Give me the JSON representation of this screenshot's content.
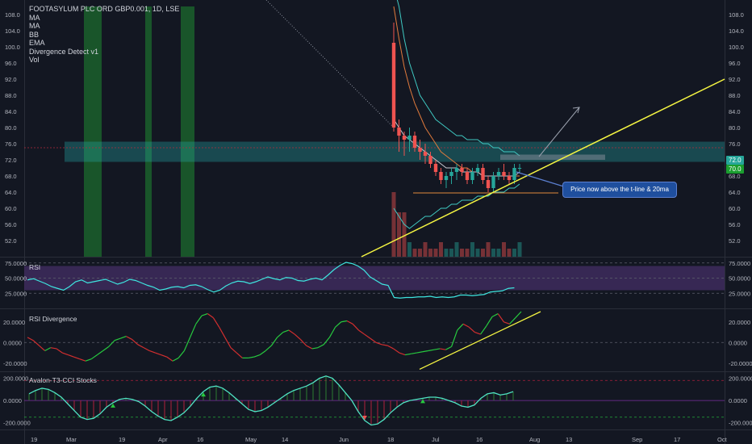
{
  "legend": {
    "symbol_line": "FOOTASYLUM PLC ORD GBP0.001, 1D, LSE",
    "indicators": [
      "MA",
      "MA",
      "BB",
      "EMA",
      "Divergence Detect v1",
      "Vol"
    ]
  },
  "annotation": {
    "text": "Price now above the t-line & 20ma"
  },
  "price_labels": {
    "last": "70.0",
    "target": "72.0"
  },
  "colors": {
    "background": "#131722",
    "up": "#26a69a",
    "down": "#ef5350",
    "trendline": "#f5f542",
    "zone": "#26a6a6",
    "rsi_line": "#3ee6e0",
    "rsi_band": "#3c2a5a",
    "green_bar": "#1c6b2d",
    "note": "#1f4f9e",
    "cci_line": "#4fe3c3",
    "hist_neg": "#b0203c",
    "hist_pos": "#2e7d32"
  },
  "chart_data": [
    {
      "type": "candlestick",
      "title": "FOOTASYLUM PLC ORD GBP0.001, 1D, LSE",
      "y_ticks": [
        "108.0",
        "104.0",
        "100.0",
        "96.0",
        "92.0",
        "88.0",
        "84.0",
        "80.0",
        "76.0",
        "72.0",
        "68.0",
        "64.0",
        "60.0",
        "56.0",
        "52.0"
      ],
      "ylim": [
        48,
        110
      ],
      "x_ticks": [
        "19",
        "Mar",
        "19",
        "Apr",
        "16",
        "May",
        "14",
        "Jun",
        "18",
        "Jul",
        "16",
        "Aug",
        "13",
        "Sep",
        "17",
        "Oct"
      ],
      "candles": [
        {
          "o": 101,
          "h": 106,
          "l": 79,
          "c": 80
        },
        {
          "o": 80,
          "h": 82,
          "l": 74,
          "c": 78
        },
        {
          "o": 78,
          "h": 79,
          "l": 73,
          "c": 77
        },
        {
          "o": 77,
          "h": 80,
          "l": 74,
          "c": 78
        },
        {
          "o": 78,
          "h": 79,
          "l": 74,
          "c": 75
        },
        {
          "o": 75,
          "h": 77,
          "l": 72,
          "c": 74
        },
        {
          "o": 74,
          "h": 76,
          "l": 71,
          "c": 73
        },
        {
          "o": 73,
          "h": 74,
          "l": 70,
          "c": 71
        },
        {
          "o": 71,
          "h": 72,
          "l": 68,
          "c": 69
        },
        {
          "o": 69,
          "h": 70,
          "l": 66,
          "c": 67
        },
        {
          "o": 67,
          "h": 69,
          "l": 65,
          "c": 68
        },
        {
          "o": 68,
          "h": 70,
          "l": 66,
          "c": 69
        },
        {
          "o": 69,
          "h": 71,
          "l": 67,
          "c": 70
        },
        {
          "o": 70,
          "h": 71,
          "l": 68,
          "c": 69
        },
        {
          "o": 69,
          "h": 70,
          "l": 66,
          "c": 67
        },
        {
          "o": 67,
          "h": 70,
          "l": 66,
          "c": 69
        },
        {
          "o": 69,
          "h": 71,
          "l": 68,
          "c": 70
        },
        {
          "o": 70,
          "h": 71,
          "l": 66,
          "c": 67
        },
        {
          "o": 67,
          "h": 68,
          "l": 64,
          "c": 65
        },
        {
          "o": 65,
          "h": 69,
          "l": 64,
          "c": 68
        },
        {
          "o": 68,
          "h": 70,
          "l": 67,
          "c": 69
        },
        {
          "o": 69,
          "h": 71,
          "l": 67,
          "c": 68
        },
        {
          "o": 68,
          "h": 69,
          "l": 66,
          "c": 67
        },
        {
          "o": 67,
          "h": 71,
          "l": 66,
          "c": 70
        },
        {
          "o": 70,
          "h": 71,
          "l": 69,
          "c": 70
        }
      ],
      "ma_slow": [
        110,
        102,
        95,
        90,
        86,
        83,
        80,
        78,
        76,
        74,
        73,
        72,
        71,
        70,
        70,
        69,
        69,
        68,
        68,
        68,
        68,
        68,
        68,
        68,
        68
      ],
      "ma_fast": [
        82,
        80,
        78,
        77,
        76,
        75,
        74,
        73,
        72,
        71,
        70,
        70,
        70,
        69,
        69,
        69,
        69,
        68,
        68,
        68,
        68,
        68,
        68,
        68,
        69
      ],
      "bb_upper": [
        120,
        110,
        102,
        96,
        92,
        88,
        86,
        84,
        82,
        81,
        80,
        79,
        78,
        78,
        77,
        77,
        77,
        76,
        76,
        75,
        75,
        74,
        74,
        74,
        73
      ],
      "bb_lower": [
        60,
        58,
        56,
        55,
        56,
        57,
        58,
        58,
        59,
        60,
        60,
        61,
        61,
        62,
        62,
        62,
        63,
        63,
        63,
        64,
        64,
        64,
        65,
        65,
        66
      ],
      "zones": [
        {
          "from": 71.5,
          "to": 76.5
        }
      ],
      "horizontal_levels": [
        63.8,
        75.0
      ],
      "green_bands": [
        "Feb 26 - Mar 3",
        "Mar 26",
        "Apr 9 - Apr 12"
      ]
    },
    {
      "type": "line",
      "title": "RSI",
      "y_ticks": [
        "75.0000",
        "50.0000",
        "25.0000"
      ],
      "ylim": [
        0,
        80
      ],
      "values": [
        47,
        49,
        45,
        41,
        36,
        33,
        30,
        36,
        44,
        47,
        42,
        44,
        46,
        48,
        44,
        40,
        43,
        48,
        46,
        42,
        38,
        35,
        30,
        32,
        35,
        36,
        34,
        38,
        39,
        36,
        31,
        27,
        30,
        37,
        42,
        45,
        44,
        41,
        44,
        48,
        52,
        49,
        47,
        51,
        50,
        46,
        45,
        48,
        50,
        47,
        55,
        64,
        71,
        76,
        74,
        70,
        63,
        52,
        46,
        40,
        38,
        18,
        17,
        18,
        18,
        19,
        19,
        20,
        18,
        19,
        18,
        19,
        22,
        22,
        21,
        22,
        23,
        27,
        28,
        29,
        33,
        34
      ]
    },
    {
      "type": "line",
      "title": "RSI Divergence",
      "y_ticks": [
        "20.0000",
        "0.0000",
        "-20.0000"
      ],
      "ylim": [
        -28,
        30
      ],
      "values": [
        5,
        2,
        -3,
        -8,
        -5,
        -6,
        -10,
        -12,
        -14,
        -16,
        -18,
        -16,
        -12,
        -8,
        -4,
        2,
        4,
        6,
        3,
        -2,
        -5,
        -8,
        -10,
        -12,
        -14,
        -18,
        -15,
        -8,
        5,
        18,
        26,
        28,
        24,
        15,
        5,
        -5,
        -10,
        -15,
        -15,
        -14,
        -12,
        -8,
        -3,
        5,
        10,
        12,
        8,
        3,
        -3,
        -6,
        -5,
        -2,
        5,
        15,
        20,
        21,
        18,
        12,
        8,
        4,
        0,
        -2,
        -3,
        -6,
        -10,
        -12,
        -11,
        -10,
        -9,
        -8,
        -7,
        -6,
        -7,
        -4,
        12,
        18,
        15,
        10,
        8,
        16,
        25,
        28,
        20,
        18,
        24,
        30
      ]
    },
    {
      "type": "line",
      "title": "Avalon-T3-CCI Stocks",
      "y_ticks": [
        "200.0000",
        "0.0000",
        "-200.0000"
      ],
      "ylim": [
        -260,
        240
      ],
      "values": [
        60,
        90,
        110,
        100,
        70,
        30,
        -30,
        -90,
        -150,
        -170,
        -160,
        -120,
        -60,
        -20,
        10,
        20,
        10,
        -10,
        -50,
        -100,
        -140,
        -170,
        -180,
        -150,
        -110,
        -50,
        20,
        80,
        120,
        130,
        110,
        70,
        20,
        -30,
        -80,
        -100,
        -90,
        -60,
        -20,
        20,
        60,
        90,
        110,
        130,
        160,
        200,
        220,
        200,
        140,
        70,
        0,
        -100,
        -180,
        -220,
        -210,
        -170,
        -110,
        -60,
        -20,
        0,
        10,
        20,
        30,
        30,
        20,
        0,
        -20,
        -50,
        -60,
        -40,
        20,
        60,
        70,
        50,
        60,
        80
      ]
    }
  ]
}
